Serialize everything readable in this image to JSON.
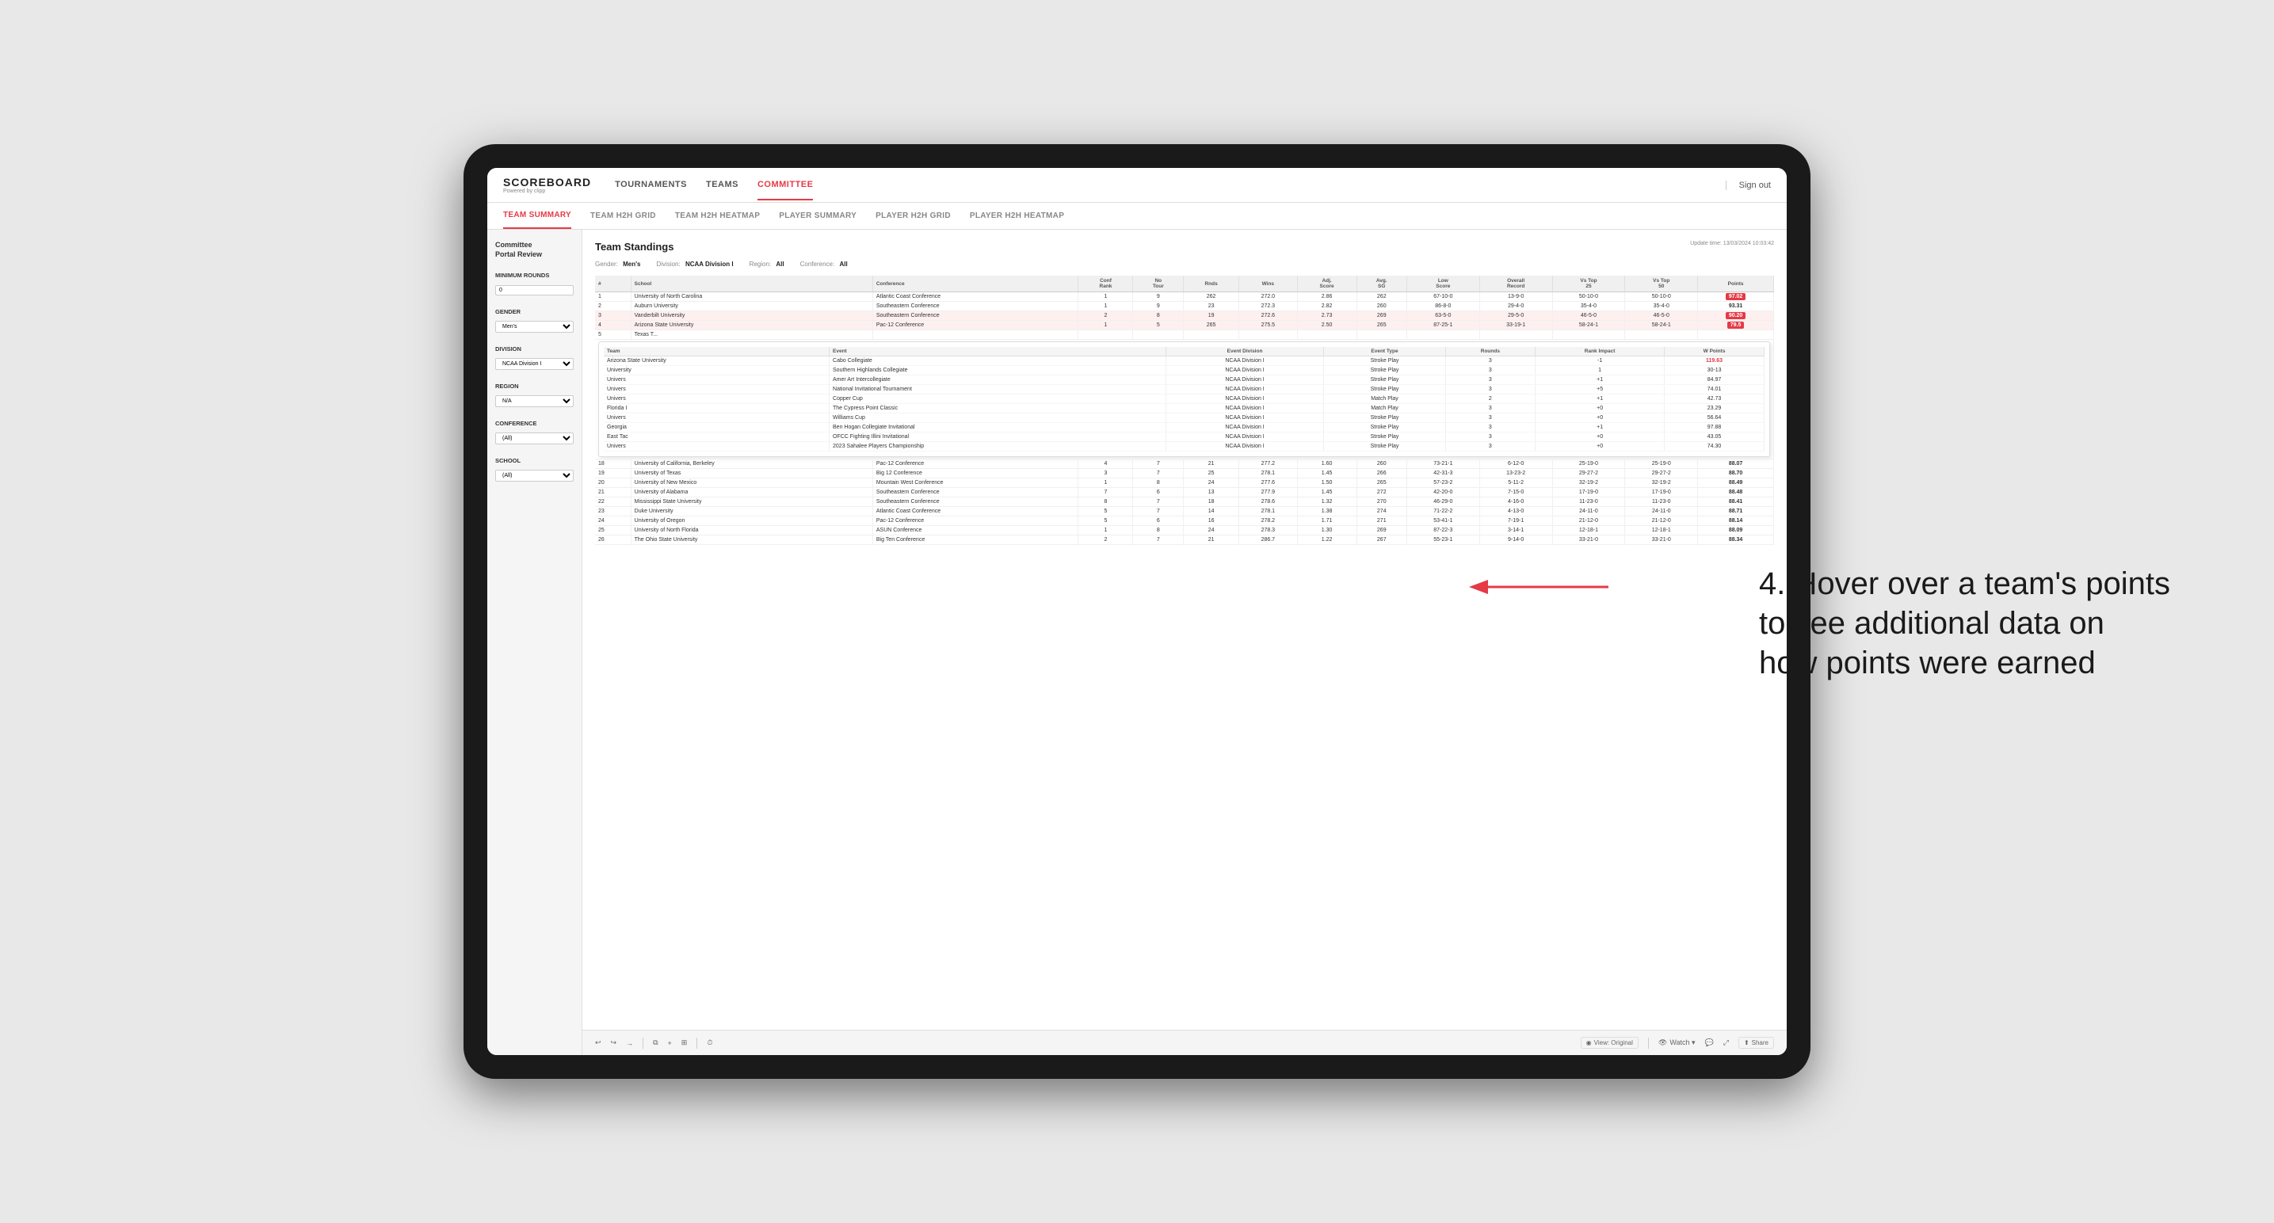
{
  "app": {
    "logo": "SCOREBOARD",
    "logo_sub": "Powered by clipp",
    "sign_out": "Sign out"
  },
  "nav": {
    "items": [
      "TOURNAMENTS",
      "TEAMS",
      "COMMITTEE"
    ],
    "active": "COMMITTEE"
  },
  "sub_nav": {
    "items": [
      "TEAM SUMMARY",
      "TEAM H2H GRID",
      "TEAM H2H HEATMAP",
      "PLAYER SUMMARY",
      "PLAYER H2H GRID",
      "PLAYER H2H HEATMAP"
    ],
    "active": "TEAM SUMMARY"
  },
  "sidebar": {
    "portal_title": "Committee",
    "portal_subtitle": "Portal Review",
    "sections": [
      {
        "label": "Minimum Rounds",
        "type": "input",
        "value": "0"
      },
      {
        "label": "Gender",
        "type": "select",
        "value": "Men's"
      },
      {
        "label": "Division",
        "type": "select",
        "value": "NCAA Division I"
      },
      {
        "label": "Region",
        "type": "select",
        "value": "N/A"
      },
      {
        "label": "Conference",
        "type": "select",
        "value": "(All)"
      },
      {
        "label": "School",
        "type": "select",
        "value": "(All)"
      }
    ]
  },
  "report": {
    "title": "Team Standings",
    "update_time": "Update time: 13/03/2024 10:03:42",
    "filters": {
      "gender": {
        "label": "Gender:",
        "value": "Men's"
      },
      "division": {
        "label": "Division:",
        "value": "NCAA Division I"
      },
      "region": {
        "label": "Region:",
        "value": "All"
      },
      "conference": {
        "label": "Conference:",
        "value": "All"
      }
    },
    "table_headers": [
      "#",
      "School",
      "Conference",
      "Conf Rank",
      "No Tour",
      "Rnds",
      "Wins",
      "Adj. Score",
      "Avg. SG",
      "Low Score",
      "Overall Record",
      "Vs Top 25",
      "Vs Top 50",
      "Points"
    ],
    "rows": [
      {
        "rank": "1",
        "school": "University of North Carolina",
        "conference": "Atlantic Coast Conference",
        "conf_rank": "1",
        "no_tour": "9",
        "rnds": "262",
        "wins": "272.0",
        "adj_score": "2.86",
        "avg_sg": "262",
        "low_score": "67-10-0",
        "overall": "13-9-0",
        "vs25": "50-10-0",
        "vs50": "50-10-0",
        "points": "97.02",
        "highlighted": true
      },
      {
        "rank": "2",
        "school": "Auburn University",
        "conference": "Southeastern Conference",
        "conf_rank": "1",
        "no_tour": "9",
        "rnds": "23",
        "wins": "272.3",
        "adj_score": "2.82",
        "avg_sg": "260",
        "low_score": "86-8-0",
        "overall": "29-4-0",
        "vs25": "35-4-0",
        "vs50": "35-4-0",
        "points": "93.31"
      },
      {
        "rank": "3",
        "school": "Vanderbilt University",
        "conference": "Southeastern Conference",
        "conf_rank": "2",
        "no_tour": "8",
        "rnds": "19",
        "wins": "272.6",
        "adj_score": "2.73",
        "avg_sg": "269",
        "low_score": "63-5-0",
        "overall": "29-5-0",
        "vs25": "46-5-0",
        "vs50": "46-5-0",
        "points": "90.20",
        "highlighted": true
      },
      {
        "rank": "4",
        "school": "Arizona State University",
        "conference": "Pac-12 Conference",
        "conf_rank": "1",
        "no_tour": "5",
        "rnds": "265",
        "wins": "275.5",
        "adj_score": "2.50",
        "avg_sg": "265",
        "low_score": "87-25-1",
        "overall": "33-19-1",
        "vs25": "58-24-1",
        "vs50": "58-24-1",
        "points": "79.5",
        "highlighted": true
      },
      {
        "rank": "5",
        "school": "Texas T...",
        "conference": "",
        "conf_rank": "",
        "no_tour": "",
        "rnds": "",
        "wins": "",
        "adj_score": "",
        "avg_sg": "",
        "low_score": "",
        "overall": "",
        "vs25": "",
        "vs50": "",
        "points": ""
      }
    ],
    "tooltip_headers": [
      "Team",
      "Event",
      "Event Division",
      "Event Type",
      "Rounds",
      "Rank Impact",
      "W Points"
    ],
    "tooltip_rows": [
      {
        "team": "University",
        "event": "Cabo Collegiate",
        "division": "NCAA Division I",
        "type": "Stroke Play",
        "rounds": "3",
        "impact": "-1",
        "w_points": "119.63"
      },
      {
        "team": "University",
        "event": "Southern Highlands Collegiate",
        "division": "NCAA Division I",
        "type": "Stroke Play",
        "rounds": "3",
        "impact": "1",
        "w_points": "30-13"
      },
      {
        "team": "Univers",
        "event": "Amer Art Intercollegiate",
        "division": "NCAA Division I",
        "type": "Stroke Play",
        "rounds": "3",
        "impact": "+1",
        "w_points": "84.97"
      },
      {
        "team": "Univers",
        "event": "National Invitational Tournament",
        "division": "NCAA Division I",
        "type": "Stroke Play",
        "rounds": "3",
        "impact": "+5",
        "w_points": "74.01"
      },
      {
        "team": "Univers",
        "event": "Copper Cup",
        "division": "NCAA Division I",
        "type": "Match Play",
        "rounds": "2",
        "impact": "+1",
        "w_points": "42.73"
      },
      {
        "team": "Florida I",
        "event": "The Cypress Point Classic",
        "division": "NCAA Division I",
        "type": "Match Play",
        "rounds": "3",
        "impact": "+0",
        "w_points": "23.29"
      },
      {
        "team": "Univers",
        "event": "Williams Cup",
        "division": "NCAA Division I",
        "type": "Stroke Play",
        "rounds": "3",
        "impact": "+0",
        "w_points": "56-64"
      },
      {
        "team": "Georgia",
        "event": "Ben Hogan Collegiate Invitational",
        "division": "NCAA Division I",
        "type": "Stroke Play",
        "rounds": "3",
        "impact": "+1",
        "w_points": "97.88"
      },
      {
        "team": "East Tac",
        "event": "OFCC Fighting Illini Invitational",
        "division": "NCAA Division I",
        "type": "Stroke Play",
        "rounds": "3",
        "impact": "+0",
        "w_points": "43.05"
      },
      {
        "team": "Univers",
        "event": "2023 Sahalee Players Championship",
        "division": "NCAA Division I",
        "type": "Stroke Play",
        "rounds": "3",
        "impact": "+0",
        "w_points": "74.30"
      }
    ],
    "lower_rows": [
      {
        "rank": "18",
        "school": "University of California, Berkeley",
        "conference": "Pac-12 Conference",
        "conf_rank": "4",
        "no_tour": "7",
        "rnds": "21",
        "wins": "277.2",
        "adj_score": "1.60",
        "avg_sg": "260",
        "low_score": "73-21-1",
        "overall": "6-12-0",
        "vs25": "25-19-0",
        "vs50": "25-19-0",
        "points": "88.07"
      },
      {
        "rank": "19",
        "school": "University of Texas",
        "conference": "Big 12 Conference",
        "conf_rank": "3",
        "no_tour": "7",
        "rnds": "25",
        "wins": "278.1",
        "adj_score": "1.45",
        "avg_sg": "266",
        "low_score": "42-31-3",
        "overall": "13-23-2",
        "vs25": "29-27-2",
        "vs50": "29-27-2",
        "points": "88.70"
      },
      {
        "rank": "20",
        "school": "University of New Mexico",
        "conference": "Mountain West Conference",
        "conf_rank": "1",
        "no_tour": "8",
        "rnds": "24",
        "wins": "277.6",
        "adj_score": "1.50",
        "avg_sg": "265",
        "low_score": "57-23-2",
        "overall": "5-11-2",
        "vs25": "32-19-2",
        "vs50": "32-19-2",
        "points": "88.49"
      },
      {
        "rank": "21",
        "school": "University of Alabama",
        "conference": "Southeastern Conference",
        "conf_rank": "7",
        "no_tour": "6",
        "rnds": "13",
        "wins": "277.9",
        "adj_score": "1.45",
        "avg_sg": "272",
        "low_score": "42-20-0",
        "overall": "7-15-0",
        "vs25": "17-19-0",
        "vs50": "17-19-0",
        "points": "88.48"
      },
      {
        "rank": "22",
        "school": "Mississippi State University",
        "conference": "Southeastern Conference",
        "conf_rank": "8",
        "no_tour": "7",
        "rnds": "18",
        "wins": "278.6",
        "adj_score": "1.32",
        "avg_sg": "270",
        "low_score": "46-29-0",
        "overall": "4-16-0",
        "vs25": "11-23-0",
        "vs50": "11-23-0",
        "points": "88.41"
      },
      {
        "rank": "23",
        "school": "Duke University",
        "conference": "Atlantic Coast Conference",
        "conf_rank": "5",
        "no_tour": "7",
        "rnds": "14",
        "wins": "278.1",
        "adj_score": "1.38",
        "avg_sg": "274",
        "low_score": "71-22-2",
        "overall": "4-13-0",
        "vs25": "24-11-0",
        "vs50": "24-11-0",
        "points": "88.71"
      },
      {
        "rank": "24",
        "school": "University of Oregon",
        "conference": "Pac-12 Conference",
        "conf_rank": "5",
        "no_tour": "6",
        "rnds": "16",
        "wins": "278.2",
        "adj_score": "1.71",
        "avg_sg": "271",
        "low_score": "53-41-1",
        "overall": "7-19-1",
        "vs25": "21-12-0",
        "vs50": "21-12-0",
        "points": "88.14"
      },
      {
        "rank": "25",
        "school": "University of North Florida",
        "conference": "ASUN Conference",
        "conf_rank": "1",
        "no_tour": "8",
        "rnds": "24",
        "wins": "278.3",
        "adj_score": "1.30",
        "avg_sg": "269",
        "low_score": "87-22-3",
        "overall": "3-14-1",
        "vs25": "12-18-1",
        "vs50": "12-18-1",
        "points": "88.09"
      },
      {
        "rank": "26",
        "school": "The Ohio State University",
        "conference": "Big Ten Conference",
        "conf_rank": "2",
        "no_tour": "7",
        "rnds": "21",
        "wins": "286.7",
        "adj_score": "1.22",
        "avg_sg": "267",
        "low_score": "55-23-1",
        "overall": "9-14-0",
        "vs25": "33-21-0",
        "vs50": "33-21-0",
        "points": "88.34"
      }
    ]
  },
  "toolbar": {
    "undo": "↩",
    "redo": "↪",
    "forward": "→",
    "copy": "⧉",
    "paste": "⊕",
    "clock": "⏱",
    "view_label": "View: Original",
    "watch_label": "Watch ▾",
    "share_label": "Share"
  },
  "annotation": {
    "text": "4. Hover over a team's points to see additional data on how points were earned"
  }
}
